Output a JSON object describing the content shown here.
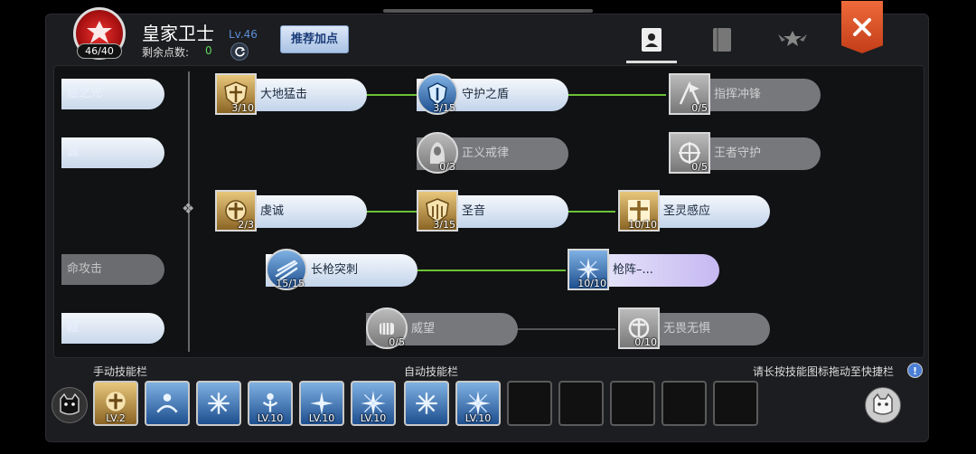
{
  "header": {
    "class_name": "皇家卫士",
    "class_level": "Lv.46",
    "level_badge": "46/40",
    "points_label": "剩余点数:",
    "points_value": "0",
    "recommend_label": "推荐加点"
  },
  "tabs": [
    {
      "icon": "skill-book-icon",
      "active": true
    },
    {
      "icon": "book-icon",
      "active": false
    },
    {
      "icon": "winged-emblem-icon",
      "active": false
    }
  ],
  "left_column": [
    {
      "label": "临之光",
      "state": "on"
    },
    {
      "label": "诚",
      "state": "on"
    },
    {
      "label": "命攻击",
      "state": "off"
    },
    {
      "label": "瓯",
      "state": "on"
    }
  ],
  "skills": [
    {
      "name": "大地猛击",
      "count": "3/10",
      "state": "on",
      "icon_style": "gold"
    },
    {
      "name": "守护之盾",
      "count": "3/15",
      "state": "on",
      "icon_style": "blue"
    },
    {
      "name": "指挥冲锋",
      "count": "0/5",
      "state": "off",
      "icon_style": "gray"
    },
    {
      "name": "正义戒律",
      "count": "0/3",
      "state": "off",
      "icon_style": "gray"
    },
    {
      "name": "王者守护",
      "count": "0/5",
      "state": "off",
      "icon_style": "gray"
    },
    {
      "name": "虔诚",
      "count": "2/3",
      "state": "on",
      "icon_style": "gold"
    },
    {
      "name": "圣音",
      "count": "3/15",
      "state": "on",
      "icon_style": "gold"
    },
    {
      "name": "圣灵感应",
      "count": "10/10",
      "state": "on",
      "icon_style": "gold"
    },
    {
      "name": "长枪突刺",
      "count": "15/15",
      "state": "on",
      "icon_style": "blue"
    },
    {
      "name": "枪阵–...",
      "count": "10/10",
      "state": "purple",
      "icon_style": "blue"
    },
    {
      "name": "威望",
      "count": "0/5",
      "state": "off",
      "icon_style": "gray"
    },
    {
      "name": "无畏无惧",
      "count": "0/10",
      "state": "off",
      "icon_style": "gray"
    }
  ],
  "hotbar": {
    "manual_label": "手动技能栏",
    "auto_label": "自动技能栏",
    "hint": "请长按技能图标拖动至快捷栏",
    "hint_icon": "!",
    "manual_slots": [
      {
        "lv": "LV.2",
        "style": "gold"
      },
      {
        "lv": "",
        "style": "blue"
      },
      {
        "lv": "",
        "style": "blue"
      },
      {
        "lv": "LV.10",
        "style": "blue"
      },
      {
        "lv": "LV.10",
        "style": "blue"
      },
      {
        "lv": "LV.10",
        "style": "blue"
      }
    ],
    "auto_slots": [
      {
        "lv": "",
        "style": "blue"
      },
      {
        "lv": "LV.10",
        "style": "blue"
      },
      {
        "lv": "",
        "style": "empty"
      },
      {
        "lv": "",
        "style": "empty"
      },
      {
        "lv": "",
        "style": "empty"
      },
      {
        "lv": "",
        "style": "empty"
      },
      {
        "lv": "",
        "style": "empty"
      }
    ]
  },
  "colors": {
    "connector_active": "#6bc236",
    "close_button": "#e1532a",
    "level_text": "#5b8ed6"
  }
}
